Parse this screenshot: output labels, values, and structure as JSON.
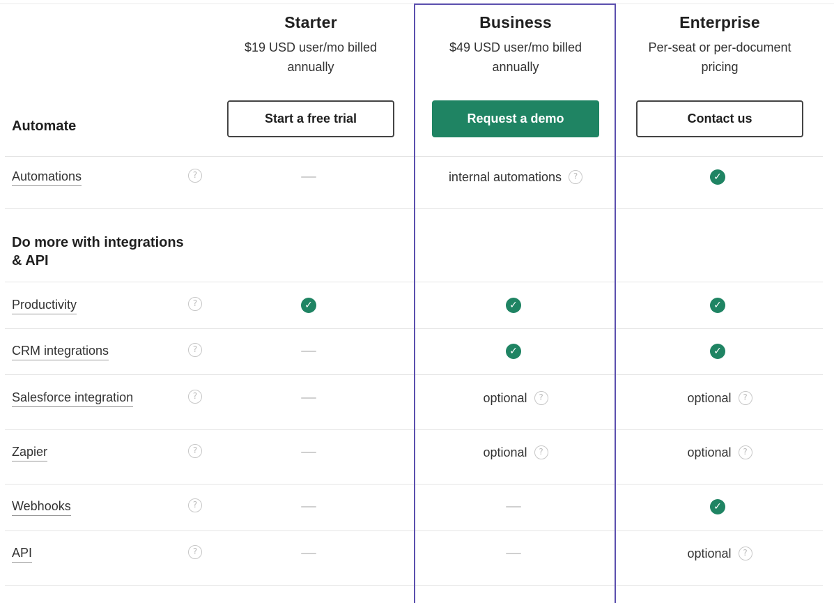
{
  "plans": [
    {
      "name": "Starter",
      "price": "$19 USD user/mo billed annually",
      "cta": "Start a free trial"
    },
    {
      "name": "Business",
      "price": "$49 USD user/mo billed annually",
      "cta": "Request a demo"
    },
    {
      "name": "Enterprise",
      "price": "Per-seat or per-document pricing",
      "cta": "Contact us"
    }
  ],
  "sections": [
    {
      "title": "Automate"
    },
    {
      "title": "Do more with integrations & API"
    }
  ],
  "features": [
    {
      "label": "Automations",
      "values": [
        "—",
        "internal automations",
        "✓"
      ]
    },
    {
      "label": "Productivity",
      "values": [
        "✓",
        "✓",
        "✓"
      ]
    },
    {
      "label": "CRM integrations",
      "values": [
        "—",
        "✓",
        "✓"
      ]
    },
    {
      "label": "Salesforce integration",
      "values": [
        "—",
        "optional",
        "optional"
      ]
    },
    {
      "label": "Zapier",
      "values": [
        "—",
        "optional",
        "optional"
      ]
    },
    {
      "label": "Webhooks",
      "values": [
        "—",
        "—",
        "✓"
      ]
    },
    {
      "label": "API",
      "values": [
        "—",
        "—",
        "optional"
      ]
    }
  ],
  "icons": {
    "help": "question-circle-icon",
    "check": "check-circle-icon",
    "dash": "dash-icon"
  },
  "glyphs": {
    "help": "?",
    "check": "✓"
  },
  "colors": {
    "accent": "#1f8463",
    "highlight_border": "#5b4fae"
  }
}
